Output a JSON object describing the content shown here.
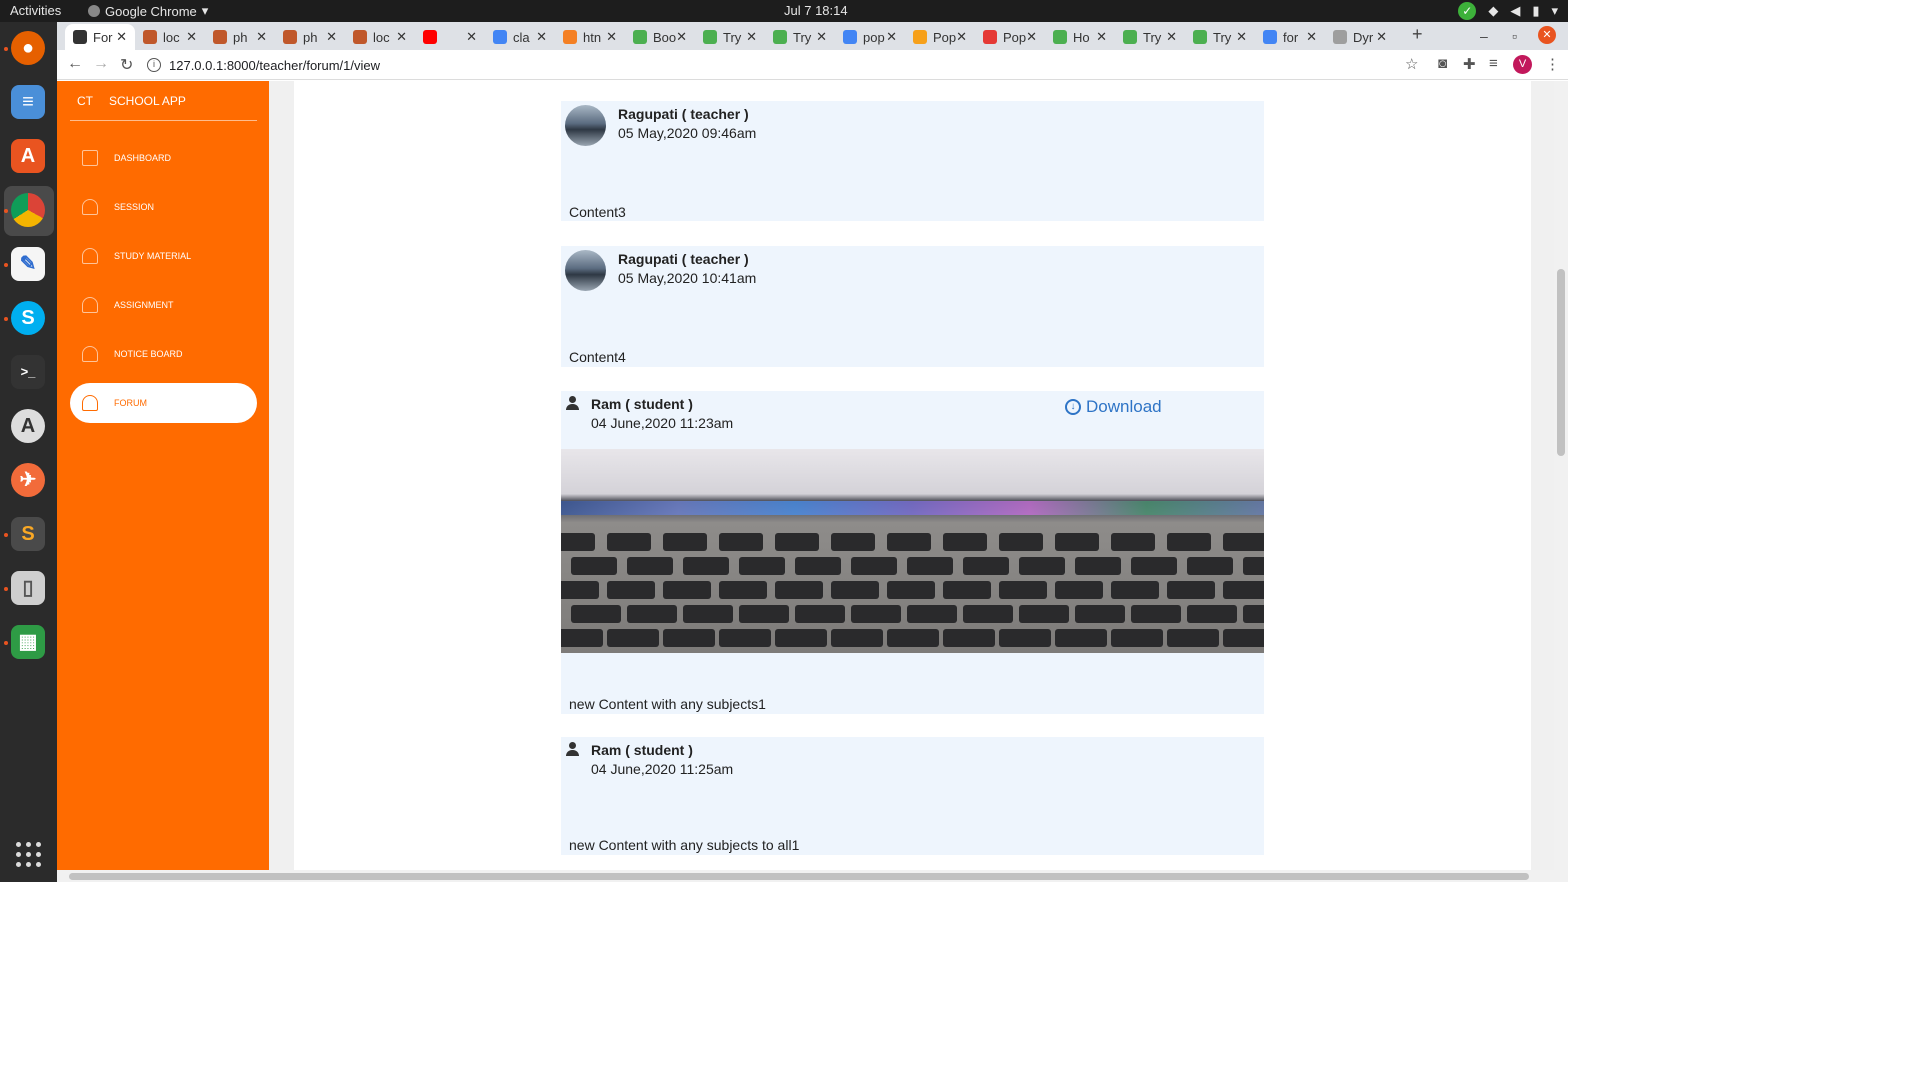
{
  "system": {
    "activities": "Activities",
    "app_name": "Google Chrome",
    "clock": "Jul 7  18:14"
  },
  "browser": {
    "tabs": [
      {
        "label": "For",
        "icon": "page-icon",
        "color": "#333333",
        "active": true
      },
      {
        "label": "loc",
        "icon": "xampp-icon",
        "color": "#c0582b"
      },
      {
        "label": "ph",
        "icon": "xampp-icon",
        "color": "#c0582b"
      },
      {
        "label": "ph",
        "icon": "xampp-icon",
        "color": "#c0582b"
      },
      {
        "label": "loc",
        "icon": "xampp-icon",
        "color": "#c0582b"
      },
      {
        "label": "",
        "icon": "youtube-icon",
        "color": "#ff0000"
      },
      {
        "label": "cla",
        "icon": "google-icon",
        "color": "#4285f4"
      },
      {
        "label": "htn",
        "icon": "stackoverflow-icon",
        "color": "#f48024"
      },
      {
        "label": "Boo",
        "icon": "w3schools-icon",
        "color": "#4caf50"
      },
      {
        "label": "Try",
        "icon": "w3schools-icon",
        "color": "#4caf50"
      },
      {
        "label": "Try",
        "icon": "w3schools-icon",
        "color": "#4caf50"
      },
      {
        "label": "pop",
        "icon": "google-icon",
        "color": "#4285f4"
      },
      {
        "label": "Pop",
        "icon": "web-icon",
        "color": "#f6a01a"
      },
      {
        "label": "Pop",
        "icon": "blocked-icon",
        "color": "#e53935"
      },
      {
        "label": "Ho",
        "icon": "w3schools-icon",
        "color": "#4caf50"
      },
      {
        "label": "Try",
        "icon": "w3schools-icon",
        "color": "#4caf50"
      },
      {
        "label": "Try",
        "icon": "w3schools-icon",
        "color": "#4caf50"
      },
      {
        "label": "for",
        "icon": "google-icon",
        "color": "#4285f4"
      },
      {
        "label": "Dyr",
        "icon": "web-icon",
        "color": "#9e9e9e"
      }
    ],
    "new_tab": "+",
    "url": "127.0.0.1:8000/teacher/forum/1/view",
    "profile_initial": "V"
  },
  "sidebar": {
    "brand_short": "CT",
    "brand_name": "SCHOOL APP",
    "accent": "#ff6b00",
    "items": [
      {
        "label": "DASHBOARD",
        "icon": "cube-icon"
      },
      {
        "label": "SESSION",
        "icon": "bell-icon"
      },
      {
        "label": "STUDY MATERIAL",
        "icon": "bell-icon"
      },
      {
        "label": "ASSIGNMENT",
        "icon": "bell-icon"
      },
      {
        "label": "NOTICE BOARD",
        "icon": "bell-icon"
      },
      {
        "label": "FORUM",
        "icon": "bell-icon",
        "active": true
      }
    ]
  },
  "posts": [
    {
      "author": "Ragupati ( teacher )",
      "date": "05 May,2020 09:46am",
      "content": "Content3",
      "avatar": "photo"
    },
    {
      "author": "Ragupati ( teacher )",
      "date": "05 May,2020 10:41am",
      "content": "Content4",
      "avatar": "photo"
    },
    {
      "author": "Ram ( student )",
      "date": "04 June,2020 11:23am",
      "content": "new Content with any subjects1",
      "avatar": "user-icon",
      "download_label": "Download",
      "attachment": "keyboard photo"
    },
    {
      "author": "Ram ( student )",
      "date": "04 June,2020 11:25am",
      "content": "new Content with any subjects to all1",
      "avatar": "user-icon"
    }
  ]
}
